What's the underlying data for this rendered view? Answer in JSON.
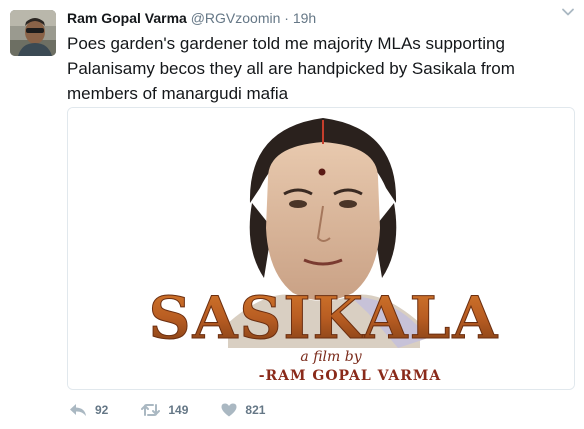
{
  "tweet": {
    "author_name": "Ram Gopal Varma",
    "handle": "@RGVzoomin",
    "separator": "·",
    "time": "19h",
    "text": "Poes garden's gardener told me majority MLAs supporting Palanisamy becos they all are handpicked by Sasikala from members of manargudi mafia"
  },
  "media": {
    "poster_title": "SASIKALA",
    "poster_subtitle": "a film by",
    "poster_credit": "-RAM GOPAL VARMA"
  },
  "actions": {
    "reply_count": "92",
    "retweet_count": "149",
    "like_count": "821"
  },
  "icons": {
    "reply": "reply-icon",
    "retweet": "retweet-icon",
    "like": "heart-icon",
    "more": "chevron-down-icon"
  },
  "colors": {
    "text": "#14171a",
    "secondary": "#657786",
    "border": "#e1e8ed",
    "action_icon": "#aab8c2"
  }
}
